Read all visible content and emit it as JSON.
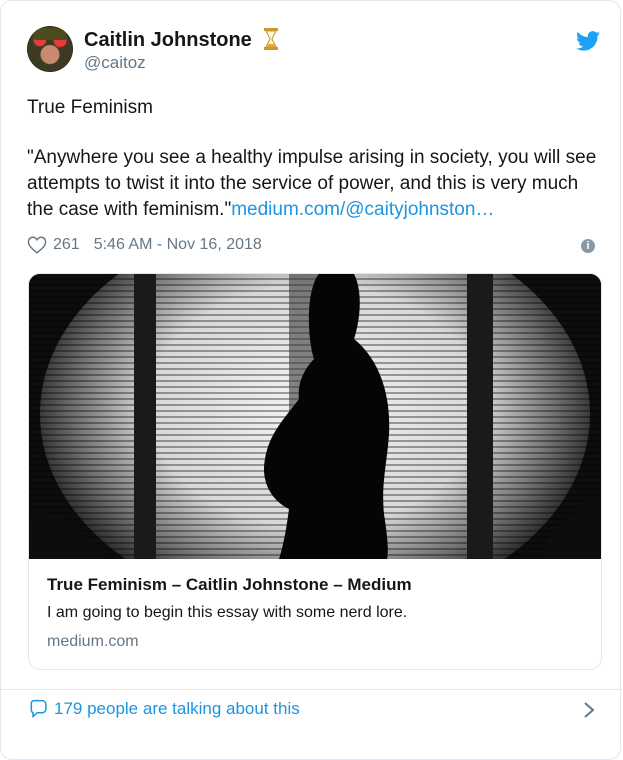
{
  "tweet": {
    "author_name": "Caitlin Johnstone",
    "author_handle": "@caitoz",
    "title_line": "True Feminism",
    "body_text": "\"Anywhere you see a healthy impulse arising in society, you will see attempts to twist it into the service of power, and this is very much the case with feminism.\"",
    "body_link": "medium.com/@caityjohnston…",
    "like_count": "261",
    "timestamp": "5:46 AM - Nov 16, 2018",
    "info_glyph": "i"
  },
  "card": {
    "title": "True Feminism – Caitlin Johnstone – Medium",
    "description": "I am going to begin this essay with some nerd lore.",
    "domain": "medium.com"
  },
  "footer": {
    "conversation_text": "179 people are talking about this"
  },
  "colors": {
    "link": "#1b95e0",
    "muted": "#657786",
    "border": "#e1e8ed",
    "text": "#14171a"
  },
  "icons": [
    "twitter-bird-icon",
    "hourglass-icon",
    "heart-icon",
    "info-icon",
    "speech-bubble-icon",
    "chevron-right-icon"
  ]
}
